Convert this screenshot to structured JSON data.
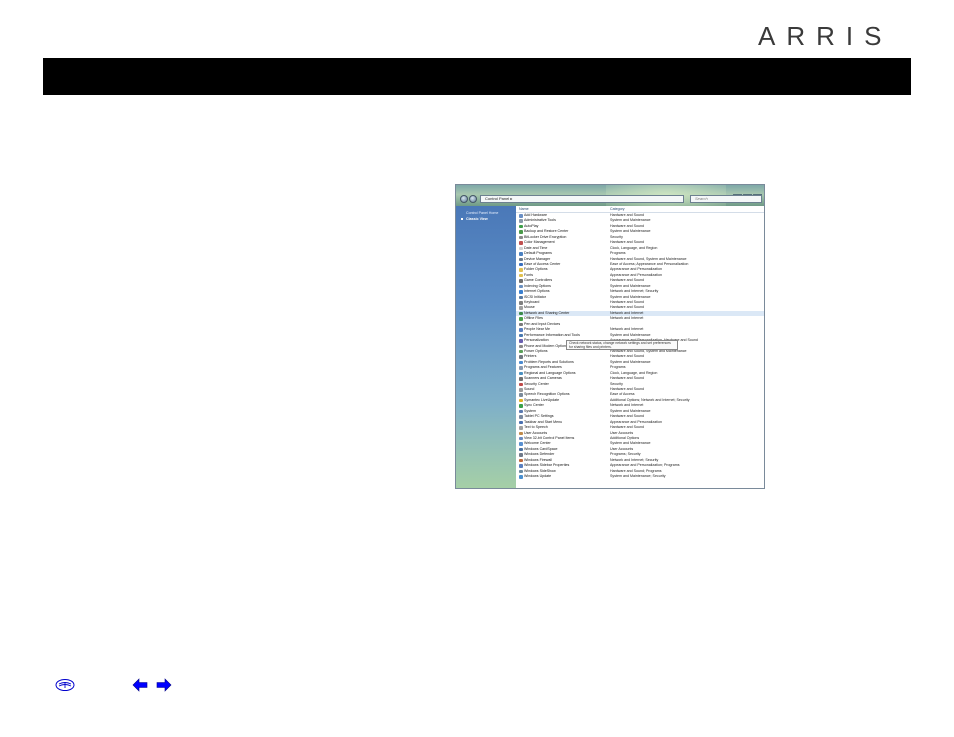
{
  "header": {
    "logo_text": "ARRIS",
    "bar_color": "#000000"
  },
  "control_panel": {
    "address": "Control Panel ▸",
    "search_placeholder": "Search",
    "sidebar": {
      "items": [
        "Control Panel Home",
        "Classic View"
      ]
    },
    "columns": [
      "Name",
      "Category"
    ],
    "tooltip": "Check network status, change network settings and set preferences for sharing files and printers.",
    "selected_index": 18,
    "rows": [
      {
        "name": "Add Hardware",
        "category": "Hardware and Sound",
        "color": "#6a8fc4"
      },
      {
        "name": "Administrative Tools",
        "category": "System and Maintenance",
        "color": "#8a9aaa"
      },
      {
        "name": "AutoPlay",
        "category": "Hardware and Sound",
        "color": "#3fa04a"
      },
      {
        "name": "Backup and Restore Center",
        "category": "System and Maintenance",
        "color": "#4a9a4a"
      },
      {
        "name": "BitLocker Drive Encryption",
        "category": "Security",
        "color": "#8a8a8a"
      },
      {
        "name": "Color Management",
        "category": "Hardware and Sound",
        "color": "#c05050"
      },
      {
        "name": "Date and Time",
        "category": "Clock, Language, and Region",
        "color": "#d0d0d0"
      },
      {
        "name": "Default Programs",
        "category": "Programs",
        "color": "#4a80c0"
      },
      {
        "name": "Device Manager",
        "category": "Hardware and Sound, System and Maintenance",
        "color": "#6a7a8a"
      },
      {
        "name": "Ease of Access Center",
        "category": "Ease of Access; Appearance and Personalization",
        "color": "#3a70c0"
      },
      {
        "name": "Folder Options",
        "category": "Appearance and Personalization",
        "color": "#e0c050"
      },
      {
        "name": "Fonts",
        "category": "Appearance and Personalization",
        "color": "#e0c050"
      },
      {
        "name": "Game Controllers",
        "category": "Hardware and Sound",
        "color": "#707070"
      },
      {
        "name": "Indexing Options",
        "category": "System and Maintenance",
        "color": "#6a90c0"
      },
      {
        "name": "Internet Options",
        "category": "Network and Internet; Security",
        "color": "#3a80d0"
      },
      {
        "name": "iSCSI Initiator",
        "category": "System and Maintenance",
        "color": "#5a7aa0"
      },
      {
        "name": "Keyboard",
        "category": "Hardware and Sound",
        "color": "#808080"
      },
      {
        "name": "Mouse",
        "category": "Hardware and Sound",
        "color": "#a0a0a0"
      },
      {
        "name": "Network and Sharing Center",
        "category": "Network and Internet",
        "color": "#3a8a4a"
      },
      {
        "name": "Offline Files",
        "category": "Network and Internet",
        "color": "#4aa04a"
      },
      {
        "name": "Pen and Input Devices",
        "category": "",
        "color": "#7a7a7a"
      },
      {
        "name": "People Near Me",
        "category": "Network and Internet",
        "color": "#5a80c0"
      },
      {
        "name": "Performance Information and Tools",
        "category": "System and Maintenance",
        "color": "#4a7ab0"
      },
      {
        "name": "Personalization",
        "category": "Appearance and Personalization, Hardware and Sound",
        "color": "#6a60b0"
      },
      {
        "name": "Phone and Modem Options",
        "category": "Hardware and Sound",
        "color": "#8a8a8a"
      },
      {
        "name": "Power Options",
        "category": "Hardware and Sound, System and Maintenance",
        "color": "#5aa05a"
      },
      {
        "name": "Printers",
        "category": "Hardware and Sound",
        "color": "#707880"
      },
      {
        "name": "Problem Reports and Solutions",
        "category": "System and Maintenance",
        "color": "#4a8ad0"
      },
      {
        "name": "Programs and Features",
        "category": "Programs",
        "color": "#8a9ab0"
      },
      {
        "name": "Regional and Language Options",
        "category": "Clock, Language, and Region",
        "color": "#4a90c0"
      },
      {
        "name": "Scanners and Cameras",
        "category": "Hardware and Sound",
        "color": "#707070"
      },
      {
        "name": "Security Center",
        "category": "Security",
        "color": "#c04a4a"
      },
      {
        "name": "Sound",
        "category": "Hardware and Sound",
        "color": "#9a9a9a"
      },
      {
        "name": "Speech Recognition Options",
        "category": "Ease of Access",
        "color": "#7a8a9a"
      },
      {
        "name": "Symantec LiveUpdate",
        "category": "Additional Options; Network and Internet; Security",
        "color": "#e0b020"
      },
      {
        "name": "Sync Center",
        "category": "Network and Internet",
        "color": "#3aa04a"
      },
      {
        "name": "System",
        "category": "System and Maintenance",
        "color": "#5a7ab0"
      },
      {
        "name": "Tablet PC Settings",
        "category": "Hardware and Sound",
        "color": "#7a8aa0"
      },
      {
        "name": "Taskbar and Start Menu",
        "category": "Appearance and Personalization",
        "color": "#4a70b0"
      },
      {
        "name": "Text to Speech",
        "category": "Hardware and Sound",
        "color": "#a0a0a0"
      },
      {
        "name": "User Accounts",
        "category": "User Accounts",
        "color": "#c08a4a"
      },
      {
        "name": "View 32-bit Control Panel Items",
        "category": "Additional Options",
        "color": "#6a8ac0"
      },
      {
        "name": "Welcome Center",
        "category": "System and Maintenance",
        "color": "#5a90d0"
      },
      {
        "name": "Windows CardSpace",
        "category": "User Accounts",
        "color": "#4a70a0"
      },
      {
        "name": "Windows Defender",
        "category": "Programs; Security",
        "color": "#707a8a"
      },
      {
        "name": "Windows Firewall",
        "category": "Network and Internet; Security",
        "color": "#c06a3a"
      },
      {
        "name": "Windows Sidebar Properties",
        "category": "Appearance and Personalization; Programs",
        "color": "#5a80c0"
      },
      {
        "name": "Windows SideShow",
        "category": "Hardware and Sound; Programs",
        "color": "#6a8aa0"
      },
      {
        "name": "Windows Update",
        "category": "System and Maintenance; Security",
        "color": "#4a90d0"
      }
    ]
  },
  "footer": {
    "icons": [
      "book-icon",
      "back-arrow-icon",
      "forward-arrow-icon"
    ],
    "arrow_color": "#0000ff"
  }
}
